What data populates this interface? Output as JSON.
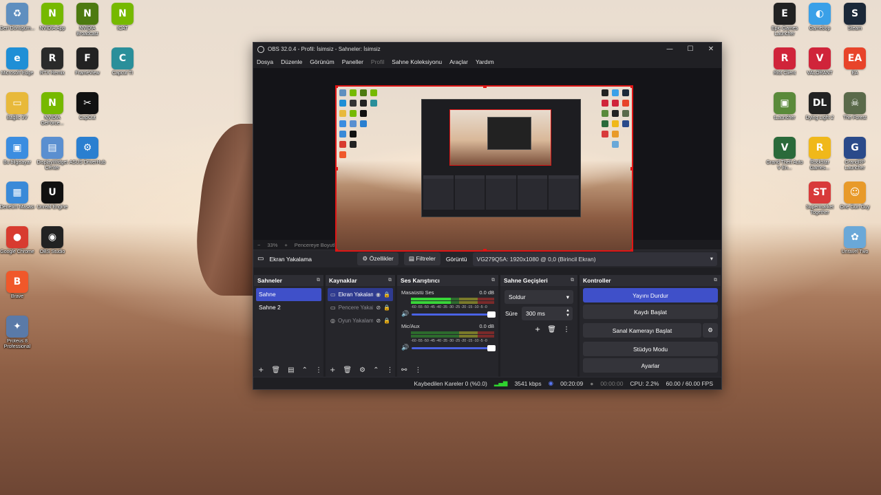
{
  "desktop": {
    "left_icons": [
      {
        "label": "Geri Dönüşüm...",
        "color": "#5f8fbf",
        "glyph": "♻"
      },
      {
        "label": "NVIDIA App",
        "color": "#76b900",
        "glyph": "N"
      },
      {
        "label": "NVIDIA Broadcast",
        "color": "#4d7a10",
        "glyph": "N"
      },
      {
        "label": "ICAT",
        "color": "#76b900",
        "glyph": "N"
      },
      {
        "label": "Microsoft Edge",
        "color": "#1f8fd6",
        "glyph": "e"
      },
      {
        "label": "RTX Remix",
        "color": "#2a2a2a",
        "glyph": "R"
      },
      {
        "label": "FrameView",
        "color": "#222",
        "glyph": "F"
      },
      {
        "label": "Capcut TI",
        "color": "#2a8f9a",
        "glyph": "C"
      },
      {
        "label": "Bağlıc 3V",
        "color": "#e8b93a",
        "glyph": "▭"
      },
      {
        "label": "NVIDIA GeForce...",
        "color": "#76b900",
        "glyph": "N"
      },
      {
        "label": "CapCut",
        "color": "#111",
        "glyph": "✂"
      },
      {
        "label": "Bu bilgisayar",
        "color": "#3b8de0",
        "glyph": "▣"
      },
      {
        "label": "DisplayWidget Center",
        "color": "#5a8fd0",
        "glyph": "▤"
      },
      {
        "label": "ASUS DriverHub",
        "color": "#2a7fd0",
        "glyph": "⚙"
      },
      {
        "label": "Denetim Masası",
        "color": "#3a8ad8",
        "glyph": "▦"
      },
      {
        "label": "Unreal Engine",
        "color": "#111",
        "glyph": "U"
      },
      {
        "label": "Google Chrome",
        "color": "#d83b2f",
        "glyph": "●"
      },
      {
        "label": "OBS Studio",
        "color": "#222",
        "glyph": "◉"
      },
      {
        "label": "Brave",
        "color": "#f0582a",
        "glyph": "B"
      },
      {
        "label": "Proteus 8 Professional",
        "color": "#5a7aa8",
        "glyph": "✦"
      }
    ],
    "right_icons": [
      {
        "label": "Epic Games Launcher",
        "color": "#222",
        "glyph": "E"
      },
      {
        "label": "Gamebop",
        "color": "#3aa0e8",
        "glyph": "◐"
      },
      {
        "label": "Steam",
        "color": "#1b2838",
        "glyph": "S"
      },
      {
        "label": "Riot Client",
        "color": "#d0243a",
        "glyph": "R"
      },
      {
        "label": "VALORANT",
        "color": "#d0243a",
        "glyph": "V"
      },
      {
        "label": "EA",
        "color": "#e8442a",
        "glyph": "EA"
      },
      {
        "label": "tLauncher",
        "color": "#5a8a3a",
        "glyph": "▣"
      },
      {
        "label": "Dying Light 2",
        "color": "#222",
        "glyph": "DL"
      },
      {
        "label": "The Forest",
        "color": "#5a6a4a",
        "glyph": "☠"
      },
      {
        "label": "Grand Theft Auto V En...",
        "color": "#2a6a3a",
        "glyph": "V"
      },
      {
        "label": "Rockstar Games...",
        "color": "#f0b81a",
        "glyph": "R"
      },
      {
        "label": "GrandRP Launcher",
        "color": "#2a4a8a",
        "glyph": "G"
      },
      {
        "label": "Supermarket Together",
        "color": "#d83a3a",
        "glyph": "ST"
      },
      {
        "label": "One Gun Guy",
        "color": "#e89a2a",
        "glyph": "☺"
      },
      {
        "label": "Unravel Two",
        "color": "#6aa8d8",
        "glyph": "✿"
      }
    ]
  },
  "window": {
    "title": "OBS 32.0.4 - Profil: İsimsiz - Sahneler: İsimsiz",
    "minimize": "—",
    "maximize": "☐",
    "close": "✕"
  },
  "menu": [
    "Dosya",
    "Düzenle",
    "Görünüm",
    "Paneller",
    "Profil",
    "Sahne Koleksiyonu",
    "Araçlar",
    "Yardım"
  ],
  "preview_bar": {
    "minus": "−",
    "zoom": "33%",
    "plus": "+",
    "mode": "Pencereye Boyutlandır",
    "arrow": "▼"
  },
  "source_toolbar": {
    "source_name": "Ekran Yakalama",
    "properties": "Özellikler",
    "filters": "Filtreler",
    "display_label": "Görüntü",
    "display_value": "VG279Q5A: 1920x1080 @ 0,0 (Birincil Ekran)"
  },
  "scenes": {
    "title": "Sahneler",
    "items": [
      "Sahne",
      "Sahne 2"
    ]
  },
  "sources": {
    "title": "Kaynaklar",
    "items": [
      "Ekran Yakalama",
      "Pencere Yakalama",
      "Oyun Yakalama"
    ]
  },
  "mixer": {
    "title": "Ses Karıştırıcı",
    "channels": [
      {
        "name": "Masaüstü Ses",
        "db": "0.0 dB"
      },
      {
        "name": "Mic/Aux",
        "db": "0.0 dB"
      }
    ],
    "scale": "-60 -55 -50 -45 -40 -35 -30 -25 -20 -15 -10 -5 -0"
  },
  "transitions": {
    "title": "Sahne Geçişleri",
    "selected": "Soldur",
    "duration_label": "Süre",
    "duration_value": "300 ms"
  },
  "controls": {
    "title": "Kontroller",
    "stop_stream": "Yayını Durdur",
    "start_record": "Kaydı Başlat",
    "virtual_cam": "Sanal Kamerayı Başlat",
    "studio_mode": "Stüdyo Modu",
    "settings": "Ayarlar"
  },
  "status": {
    "dropped": "Kaybedilen Kareler 0 (%0.0)",
    "bitrate": "3541 kbps",
    "stream_time": "00:20:09",
    "record_time": "00:00:00",
    "cpu": "CPU: 2.2%",
    "fps": "60.00 / 60.00 FPS"
  },
  "colors": {
    "accent": "#3f50c9",
    "selection_border": "#e01515",
    "signal": "#2fd32f"
  }
}
